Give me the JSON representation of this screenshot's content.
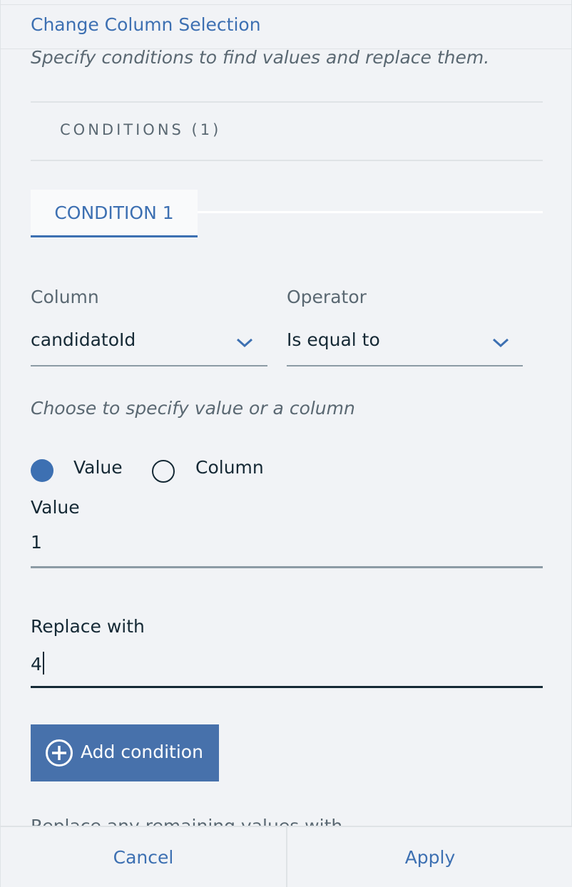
{
  "header": {
    "change_column_link": "Change Column Selection",
    "description": "Specify conditions to find values and replace them."
  },
  "conditions": {
    "title": "CONDITIONS (1)",
    "tabs": [
      {
        "label": "CONDITION 1",
        "selected": true
      }
    ]
  },
  "condition": {
    "column_label": "Column",
    "column_value": "candidatoId",
    "operator_label": "Operator",
    "operator_value": "Is equal to",
    "hint": "Choose to specify value or a column",
    "radio_options": [
      {
        "label": "Value",
        "selected": true
      },
      {
        "label": "Column",
        "selected": false
      }
    ],
    "value_label": "Value",
    "value": "1",
    "replace_label": "Replace with",
    "replace_value": "4",
    "add_button": "Add condition"
  },
  "remaining": {
    "label": "Replace any remaining values with"
  },
  "footer": {
    "cancel": "Cancel",
    "apply": "Apply"
  },
  "colors": {
    "accent": "#3d70b2",
    "button_bg": "#4771ab",
    "text": "#152935",
    "muted_text": "#5a6872",
    "background": "#f1f3f6"
  },
  "icons": {
    "column_dropdown": "chevron-down-icon",
    "operator_dropdown": "chevron-down-icon",
    "add_condition": "plus-circle-icon"
  }
}
